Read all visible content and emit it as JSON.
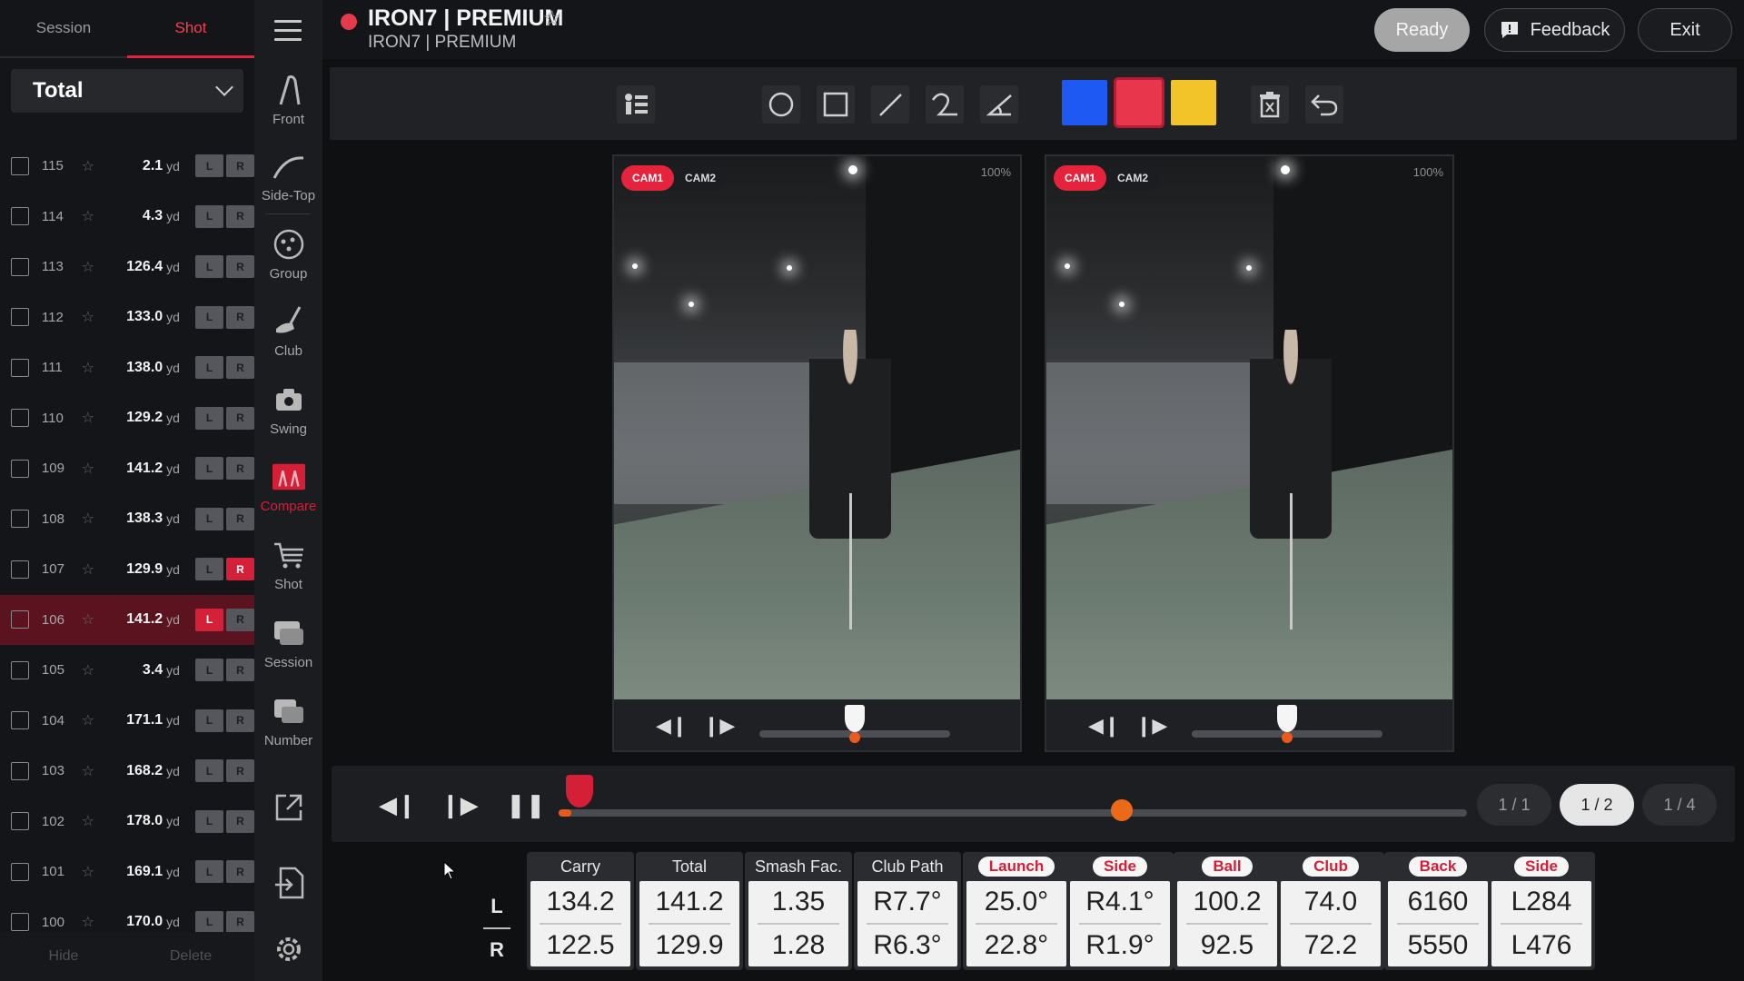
{
  "header": {
    "title": "IRON7 | PREMIUM",
    "subtitle": "IRON7 | PREMIUM",
    "ready": "Ready",
    "feedback": "Feedback",
    "exit": "Exit"
  },
  "left": {
    "tabs": [
      "Session",
      "Shot"
    ],
    "active_tab": "Shot",
    "filter": "Total",
    "shots": [
      {
        "num": "115",
        "dist": "2.1",
        "unit": "yd",
        "l": false,
        "r": false,
        "selected": false
      },
      {
        "num": "114",
        "dist": "4.3",
        "unit": "yd",
        "l": false,
        "r": false,
        "selected": false
      },
      {
        "num": "113",
        "dist": "126.4",
        "unit": "yd",
        "l": false,
        "r": false,
        "selected": false
      },
      {
        "num": "112",
        "dist": "133.0",
        "unit": "yd",
        "l": false,
        "r": false,
        "selected": false
      },
      {
        "num": "111",
        "dist": "138.0",
        "unit": "yd",
        "l": false,
        "r": false,
        "selected": false
      },
      {
        "num": "110",
        "dist": "129.2",
        "unit": "yd",
        "l": false,
        "r": false,
        "selected": false
      },
      {
        "num": "109",
        "dist": "141.2",
        "unit": "yd",
        "l": false,
        "r": false,
        "selected": false
      },
      {
        "num": "108",
        "dist": "138.3",
        "unit": "yd",
        "l": false,
        "r": false,
        "selected": false
      },
      {
        "num": "107",
        "dist": "129.9",
        "unit": "yd",
        "l": false,
        "r": true,
        "selected": false
      },
      {
        "num": "106",
        "dist": "141.2",
        "unit": "yd",
        "l": true,
        "r": false,
        "selected": true
      },
      {
        "num": "105",
        "dist": "3.4",
        "unit": "yd",
        "l": false,
        "r": false,
        "selected": false
      },
      {
        "num": "104",
        "dist": "171.1",
        "unit": "yd",
        "l": false,
        "r": false,
        "selected": false
      },
      {
        "num": "103",
        "dist": "168.2",
        "unit": "yd",
        "l": false,
        "r": false,
        "selected": false
      },
      {
        "num": "102",
        "dist": "178.0",
        "unit": "yd",
        "l": false,
        "r": false,
        "selected": false
      },
      {
        "num": "101",
        "dist": "169.1",
        "unit": "yd",
        "l": false,
        "r": false,
        "selected": false
      },
      {
        "num": "100",
        "dist": "170.0",
        "unit": "yd",
        "l": false,
        "r": false,
        "selected": false
      }
    ],
    "l_label": "L",
    "r_label": "R",
    "hide": "Hide",
    "delete": "Delete"
  },
  "iconcol": {
    "items": [
      {
        "label": "Front",
        "icon": "front-view-icon"
      },
      {
        "label": "Side-Top",
        "icon": "side-top-view-icon"
      },
      {
        "label": "Group",
        "icon": "group-icon"
      },
      {
        "label": "Club",
        "icon": "club-icon"
      },
      {
        "label": "Swing",
        "icon": "swing-camera-icon"
      },
      {
        "label": "Compare",
        "icon": "compare-icon"
      },
      {
        "label": "Shot",
        "icon": "shot-list-icon"
      },
      {
        "label": "Session",
        "icon": "session-icon"
      },
      {
        "label": "Number",
        "icon": "number-icon"
      }
    ],
    "active": "Compare"
  },
  "viewers": [
    {
      "cam_tabs": [
        "CAM1",
        "CAM2"
      ],
      "active_cam": "CAM1",
      "zoom": "100%",
      "progress": 0.5
    },
    {
      "cam_tabs": [
        "CAM1",
        "CAM2"
      ],
      "active_cam": "CAM1",
      "zoom": "100%",
      "progress": 0.5
    }
  ],
  "timeline": {
    "progress": 0.62,
    "speeds": [
      "1 / 1",
      "1 / 2",
      "1 / 4"
    ],
    "active_speed": "1 / 2"
  },
  "colors": {
    "blue": "#1f59f3",
    "red": "#e8364d",
    "yellow": "#f2c42a",
    "accent": "#d41f37"
  },
  "metrics": {
    "row_labels": [
      "L",
      "R"
    ],
    "cards": [
      {
        "headers": [
          {
            "label": "Carry",
            "pill": false
          }
        ],
        "values": [
          [
            "134.2",
            "122.5"
          ]
        ]
      },
      {
        "headers": [
          {
            "label": "Total",
            "pill": false
          }
        ],
        "values": [
          [
            "141.2",
            "129.9"
          ]
        ]
      },
      {
        "headers": [
          {
            "label": "Smash Fac.",
            "pill": false
          }
        ],
        "values": [
          [
            "1.35",
            "1.28"
          ]
        ]
      },
      {
        "headers": [
          {
            "label": "Club Path",
            "pill": false
          }
        ],
        "values": [
          [
            "R7.7°",
            "R6.3°"
          ]
        ]
      },
      {
        "headers": [
          {
            "label": "Launch",
            "pill": true
          },
          {
            "label": "Side",
            "pill": true
          }
        ],
        "values": [
          [
            "25.0°",
            "22.8°"
          ],
          [
            "R4.1°",
            "R1.9°"
          ]
        ]
      },
      {
        "headers": [
          {
            "label": "Ball",
            "pill": true
          },
          {
            "label": "Club",
            "pill": true
          }
        ],
        "values": [
          [
            "100.2",
            "92.5"
          ],
          [
            "74.0",
            "72.2"
          ]
        ]
      },
      {
        "headers": [
          {
            "label": "Back",
            "pill": true
          },
          {
            "label": "Side",
            "pill": true
          }
        ],
        "values": [
          [
            "6160",
            "5550"
          ],
          [
            "L284",
            "L476"
          ]
        ]
      }
    ]
  }
}
